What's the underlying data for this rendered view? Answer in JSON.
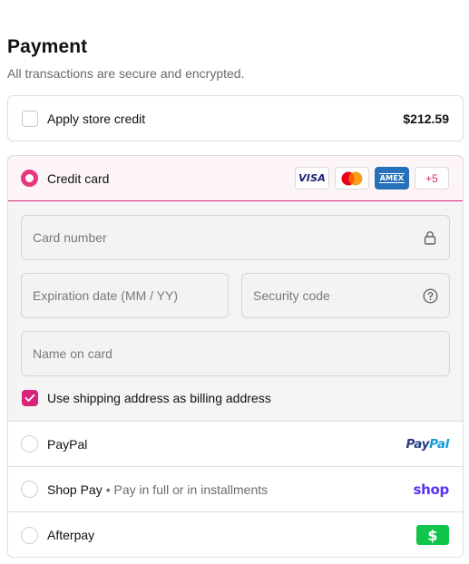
{
  "header": {
    "title": "Payment",
    "subtitle": "All transactions are secure and encrypted."
  },
  "store_credit": {
    "label": "Apply store credit",
    "amount": "$212.59",
    "checked": false
  },
  "credit_card": {
    "label": "Credit card",
    "selected": true,
    "logos": {
      "visa": "VISA",
      "mastercard": "mastercard-logo",
      "amex": "AMEX",
      "more": "+5"
    },
    "fields": {
      "card_number": "Card number",
      "expiration": "Expiration date (MM / YY)",
      "security_code": "Security code",
      "name_on_card": "Name on card"
    },
    "billing_checkbox": {
      "label": "Use shipping address as billing address",
      "checked": true
    }
  },
  "methods": {
    "paypal": {
      "label": "PayPal",
      "logo_part1": "Pay",
      "logo_part2": "Pal"
    },
    "shop_pay": {
      "label": "Shop Pay",
      "sub": "• Pay in full or in installments",
      "logo": "shop"
    },
    "afterpay": {
      "label": "Afterpay",
      "logo": "$"
    }
  },
  "colors": {
    "accent": "#d6267a",
    "radio_selected": "#e8357f",
    "paypal_dark": "#253b80",
    "paypal_light": "#179bd7",
    "shop": "#5a31f4",
    "afterpay": "#11c44a"
  }
}
